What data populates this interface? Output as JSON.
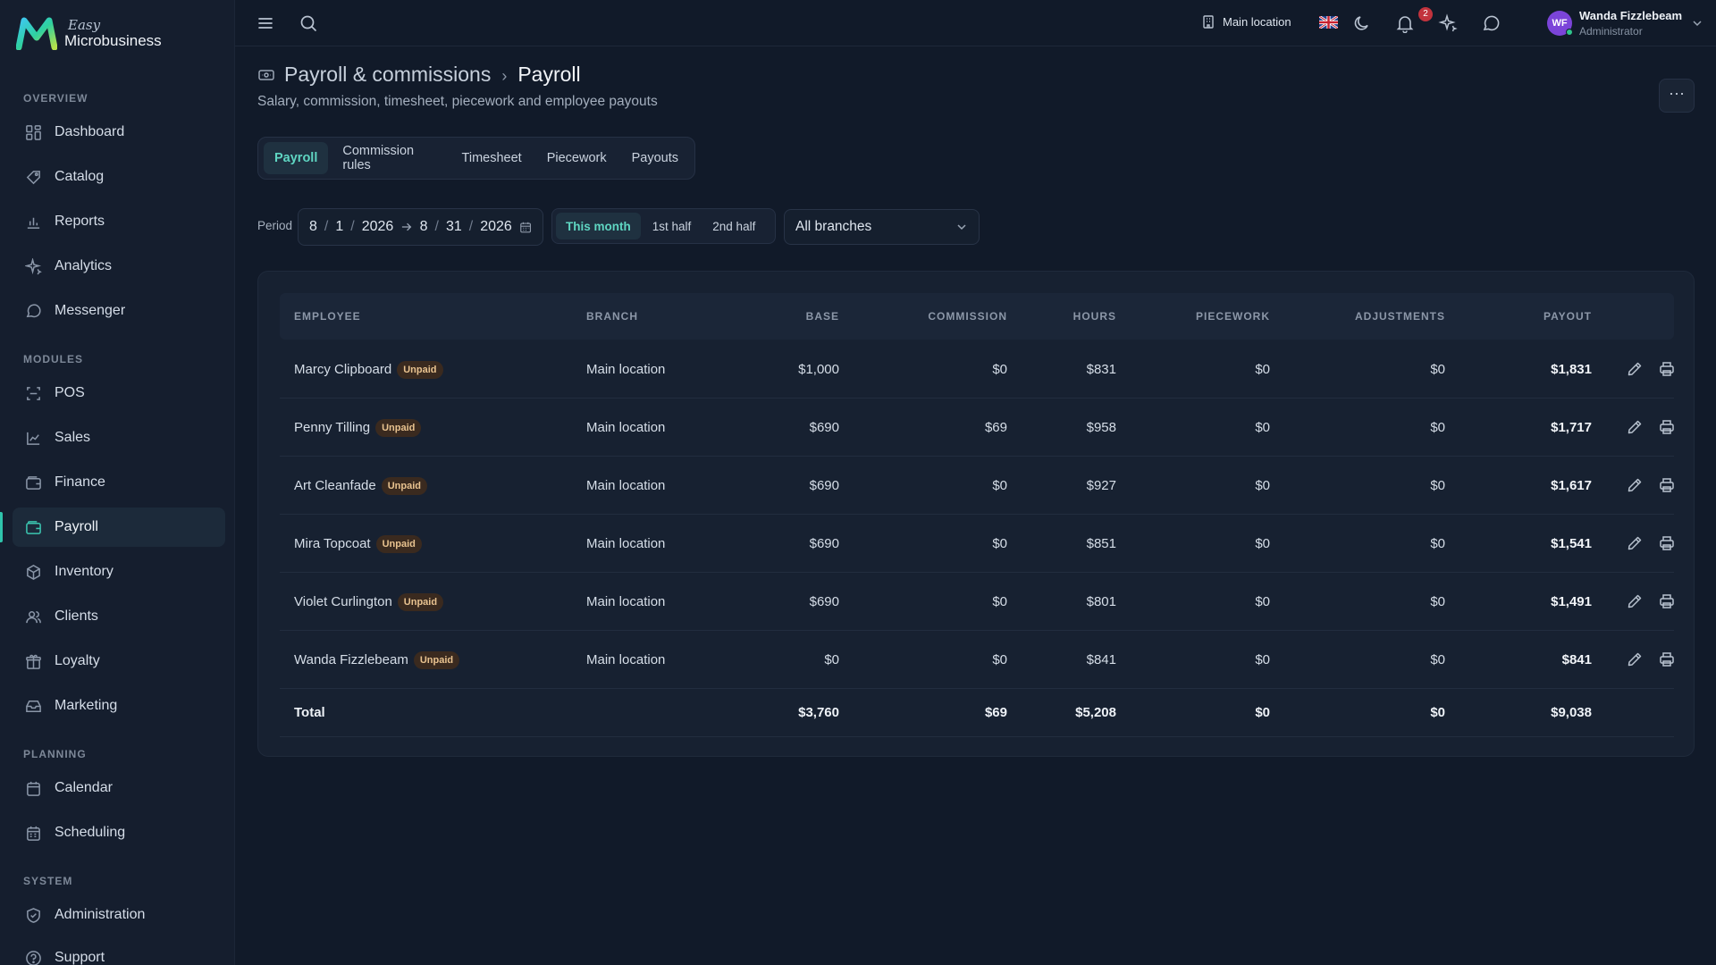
{
  "app": {
    "logo_small": "Easy",
    "logo_big": "Microbusiness"
  },
  "sidebar": {
    "sections": [
      {
        "label": "OVERVIEW"
      },
      {
        "label": "MODULES"
      },
      {
        "label": "PLANNING"
      },
      {
        "label": "SYSTEM"
      }
    ],
    "items": [
      {
        "label": "Dashboard",
        "icon": "dashboard-icon"
      },
      {
        "label": "Catalog",
        "icon": "catalog-icon"
      },
      {
        "label": "Reports",
        "icon": "reports-icon"
      },
      {
        "label": "Analytics",
        "icon": "analytics-icon"
      },
      {
        "label": "Messenger",
        "icon": "messenger-icon"
      },
      {
        "label": "POS",
        "icon": "pos-icon"
      },
      {
        "label": "Sales",
        "icon": "sales-icon"
      },
      {
        "label": "Finance",
        "icon": "finance-icon"
      },
      {
        "label": "Payroll",
        "icon": "payroll-icon",
        "active": true
      },
      {
        "label": "Inventory",
        "icon": "inventory-icon"
      },
      {
        "label": "Clients",
        "icon": "clients-icon"
      },
      {
        "label": "Loyalty",
        "icon": "loyalty-icon"
      },
      {
        "label": "Marketing",
        "icon": "marketing-icon"
      },
      {
        "label": "Calendar",
        "icon": "calendar-icon"
      },
      {
        "label": "Scheduling",
        "icon": "scheduling-icon"
      },
      {
        "label": "Administration",
        "icon": "administration-icon"
      },
      {
        "label": "Support",
        "icon": "support-icon"
      }
    ]
  },
  "topbar": {
    "location": "Main location",
    "notification_count": "2",
    "user": {
      "initials": "WF",
      "name": "Wanda Fizzlebeam",
      "role": "Administrator"
    }
  },
  "header": {
    "breadcrumb_parent": "Payroll & commissions",
    "breadcrumb_sep": "›",
    "title": "Payroll",
    "subtitle": "Salary, commission, timesheet, piecework and employee payouts",
    "more": "···"
  },
  "tabs": [
    {
      "label": "Payroll",
      "active": true
    },
    {
      "label": "Commission rules"
    },
    {
      "label": "Timesheet"
    },
    {
      "label": "Piecework"
    },
    {
      "label": "Payouts"
    }
  ],
  "filters": {
    "period_label": "Period",
    "from": {
      "m": "8",
      "d": "1",
      "y": "2026"
    },
    "to": {
      "m": "8",
      "d": "31",
      "y": "2026"
    },
    "sep": "/",
    "ranges": [
      {
        "label": "This month",
        "active": true
      },
      {
        "label": "1st half"
      },
      {
        "label": "2nd half"
      }
    ],
    "branch": "All branches"
  },
  "table": {
    "columns": [
      "EMPLOYEE",
      "BRANCH",
      "BASE",
      "COMMISSION",
      "HOURS",
      "PIECEWORK",
      "ADJUSTMENTS",
      "PAYOUT"
    ],
    "rows": [
      {
        "employee": "Marcy Clipboard",
        "status": "Unpaid",
        "branch": "Main location",
        "base": "$1,000",
        "commission": "$0",
        "hours": "$831",
        "piecework": "$0",
        "adjustments": "$0",
        "payout": "$1,831"
      },
      {
        "employee": "Penny Tilling",
        "status": "Unpaid",
        "branch": "Main location",
        "base": "$690",
        "commission": "$69",
        "hours": "$958",
        "piecework": "$0",
        "adjustments": "$0",
        "payout": "$1,717"
      },
      {
        "employee": "Art Cleanfade",
        "status": "Unpaid",
        "branch": "Main location",
        "base": "$690",
        "commission": "$0",
        "hours": "$927",
        "piecework": "$0",
        "adjustments": "$0",
        "payout": "$1,617"
      },
      {
        "employee": "Mira Topcoat",
        "status": "Unpaid",
        "branch": "Main location",
        "base": "$690",
        "commission": "$0",
        "hours": "$851",
        "piecework": "$0",
        "adjustments": "$0",
        "payout": "$1,541"
      },
      {
        "employee": "Violet Curlington",
        "status": "Unpaid",
        "branch": "Main location",
        "base": "$690",
        "commission": "$0",
        "hours": "$801",
        "piecework": "$0",
        "adjustments": "$0",
        "payout": "$1,491"
      },
      {
        "employee": "Wanda Fizzlebeam",
        "status": "Unpaid",
        "branch": "Main location",
        "base": "$0",
        "commission": "$0",
        "hours": "$841",
        "piecework": "$0",
        "adjustments": "$0",
        "payout": "$841"
      }
    ],
    "total": {
      "label": "Total",
      "base": "$3,760",
      "commission": "$69",
      "hours": "$5,208",
      "piecework": "$0",
      "adjustments": "$0",
      "payout": "$9,038"
    }
  },
  "colors": {
    "accent": "#2fc4ac",
    "background": "#111a29",
    "sidebar": "#151e2e",
    "badge_unpaid": "#e8c28f"
  }
}
